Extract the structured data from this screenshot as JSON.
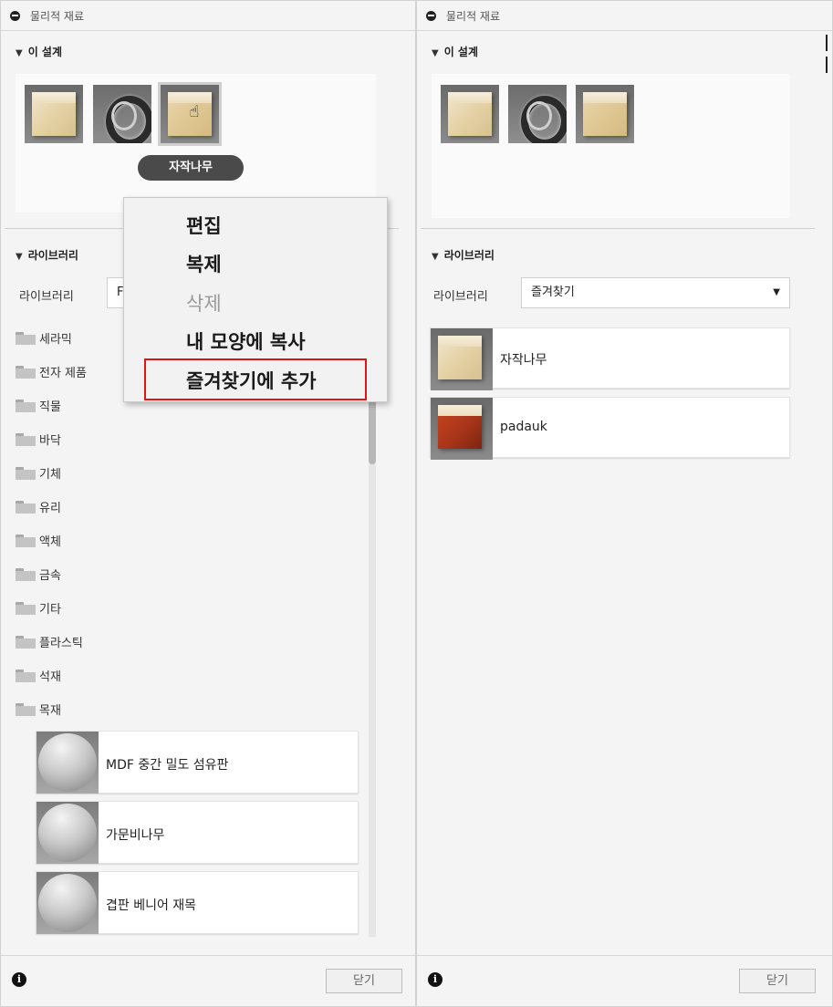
{
  "left": {
    "title": "물리적 재료",
    "design_section": "이 설계",
    "tooltip": "자작나무",
    "library_section": "라이브러리",
    "library_label": "라이브러리",
    "library_select_value": "F",
    "folders": [
      "세라믹",
      "전자 제품",
      "직물",
      "바닥",
      "기체",
      "유리",
      "액체",
      "금속",
      "기타",
      "플라스틱",
      "석재",
      "목재"
    ],
    "materials": [
      "MDF 중간 밀도 섬유판",
      "가문비나무",
      "겹판 베니어 재목"
    ],
    "close_label": "닫기"
  },
  "context_menu": {
    "edit": "편집",
    "duplicate": "복제",
    "delete": "삭제",
    "copy_to_my_appearance": "내 모양에 복사",
    "add_to_favorites": "즐겨찾기에 추가"
  },
  "right": {
    "title": "물리적 재료",
    "design_section": "이 설계",
    "library_section": "라이브러리",
    "library_label": "라이브러리",
    "library_select_value": "즐겨찾기",
    "favorites": [
      "자작나무",
      "padauk"
    ],
    "close_label": "닫기"
  },
  "icons": {
    "collapse": "minus-circle-icon",
    "expand": "triangle-down-icon",
    "folder": "folder-icon",
    "info": "info-icon",
    "dropdown": "chevron-down-icon",
    "cursor": "hand-cursor-icon"
  },
  "colors": {
    "highlight": "#e01515",
    "tooltip_bg": "#4a4a4a",
    "padauk": "#a8361a"
  }
}
